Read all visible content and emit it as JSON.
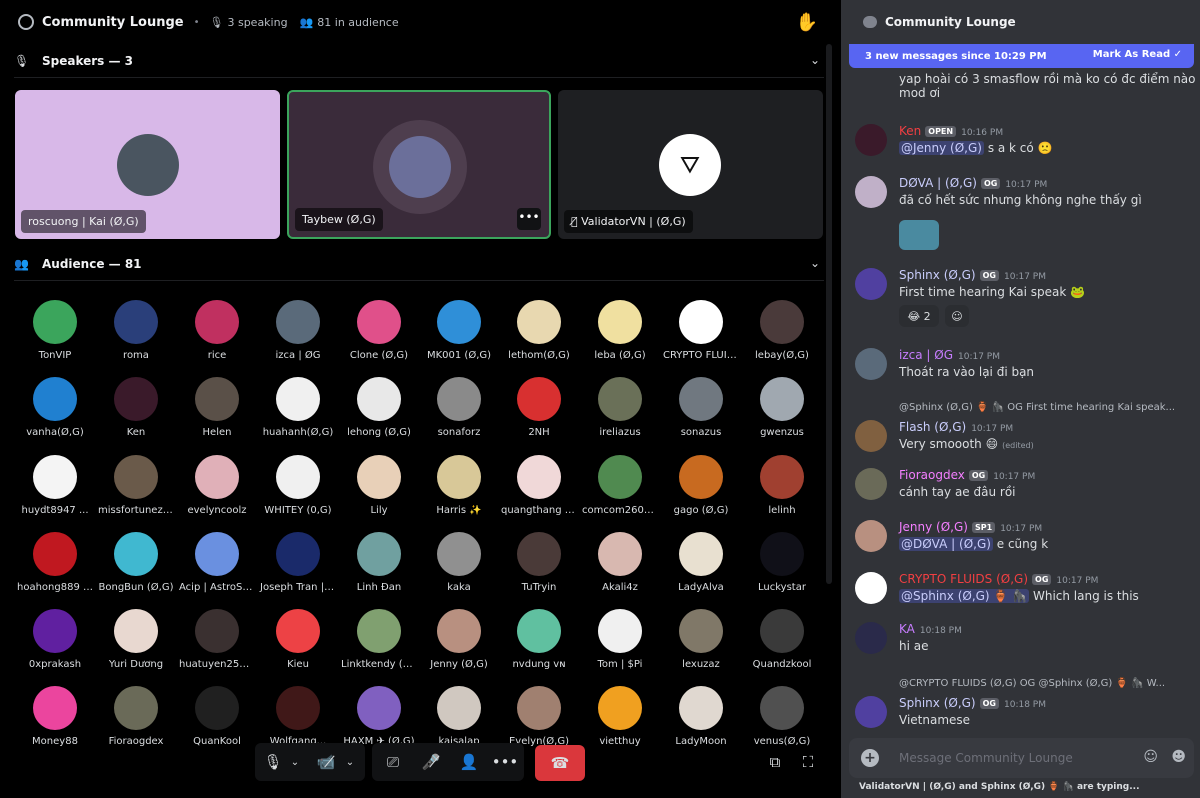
{
  "header": {
    "title": "Community Lounge",
    "speaking": "3 speaking",
    "audience": "81 in audience"
  },
  "speakers_section": {
    "title": "Speakers — 3"
  },
  "speakers": [
    {
      "label": "roscuong | Kai (Ø,G)",
      "bg": "#d8b8e8",
      "avatar": "#4a5560"
    },
    {
      "label": "Taybew (Ø,G)",
      "bg": "#3a2b3a",
      "avatar": "#6b6f9a"
    },
    {
      "label": "ValidatorVN | (Ø,G)",
      "bg": "#1e1f22",
      "avatar": "#ffffff"
    }
  ],
  "audience_section": {
    "title": "Audience — 81"
  },
  "audience": [
    {
      "name": "TonVIP",
      "color": "#3ba55c"
    },
    {
      "name": "roma",
      "color": "#2a3f7a"
    },
    {
      "name": "rice",
      "color": "#c03060"
    },
    {
      "name": "izca | ØG",
      "color": "#5a6a7a"
    },
    {
      "name": "Clone (Ø,G)",
      "color": "#e0508a"
    },
    {
      "name": "MK001 (Ø,G)",
      "color": "#2f8fd8"
    },
    {
      "name": "lethom(Ø,G)",
      "color": "#e8d8b0"
    },
    {
      "name": "leba (Ø,G)",
      "color": "#f0e0a0"
    },
    {
      "name": "CRYPTO FLUID...",
      "color": "#ffffff"
    },
    {
      "name": "lebay(Ø,G)",
      "color": "#4a3a3a"
    },
    {
      "name": "vanha(Ø,G)",
      "color": "#2080d0"
    },
    {
      "name": "Ken",
      "color": "#3a1a2a"
    },
    {
      "name": "Helen",
      "color": "#5a5048"
    },
    {
      "name": "huahanh(Ø,G)",
      "color": "#f0f0f0"
    },
    {
      "name": "lehong (Ø,G)",
      "color": "#e8e8e8"
    },
    {
      "name": "sonaforz",
      "color": "#8a8a8a"
    },
    {
      "name": "2NH",
      "color": "#d83030"
    },
    {
      "name": "ireliazus",
      "color": "#6a7058"
    },
    {
      "name": "sonazus",
      "color": "#707880"
    },
    {
      "name": "gwenzus",
      "color": "#a0a8b0"
    },
    {
      "name": "huydt8947 ...",
      "color": "#f4f4f4"
    },
    {
      "name": "missfortunezus",
      "color": "#6a5a4a"
    },
    {
      "name": "evelyncoolz",
      "color": "#e0b0b8"
    },
    {
      "name": "WHITEY (0,G)",
      "color": "#f0f0f0"
    },
    {
      "name": "Lily",
      "color": "#e8d0b8"
    },
    {
      "name": "Harris ✨",
      "color": "#d8c898"
    },
    {
      "name": "quangthang (...",
      "color": "#f0d8d8"
    },
    {
      "name": "comcom2608...",
      "color": "#508a50"
    },
    {
      "name": "gago (Ø,G)",
      "color": "#c86a20"
    },
    {
      "name": "lelinh",
      "color": "#a04030"
    },
    {
      "name": "hoahong889 (...",
      "color": "#c01820"
    },
    {
      "name": "BongBun (Ø,G)",
      "color": "#40b8d0"
    },
    {
      "name": "Acip | AstroSt...",
      "color": "#6a90e0"
    },
    {
      "name": "Joseph Tran | ...",
      "color": "#1a2a6a"
    },
    {
      "name": "Linh Đan",
      "color": "#70a0a0"
    },
    {
      "name": "kaka",
      "color": "#909090"
    },
    {
      "name": "TuTryin",
      "color": "#4a3a38"
    },
    {
      "name": "Akali4z",
      "color": "#d8b8b0"
    },
    {
      "name": "LadyAlva",
      "color": "#e8e0d0"
    },
    {
      "name": "Luckystar",
      "color": "#101018"
    },
    {
      "name": "0xprakash",
      "color": "#6020a0"
    },
    {
      "name": "Yuri Dương",
      "color": "#e8d8d0"
    },
    {
      "name": "huatuyen2512...",
      "color": "#3a3030"
    },
    {
      "name": "Kieu",
      "color": "#ed4245"
    },
    {
      "name": "Linktkendy (Ø...",
      "color": "#80a070"
    },
    {
      "name": "Jenny (Ø,G)",
      "color": "#b89080"
    },
    {
      "name": "nvdung ᴠɴ",
      "color": "#60c0a0"
    },
    {
      "name": "Tom | $Pi",
      "color": "#f0f0f0"
    },
    {
      "name": "lexuzaz",
      "color": "#807868"
    },
    {
      "name": "Quandzkool",
      "color": "#3a3a3a"
    },
    {
      "name": "Money88",
      "color": "#eb459e"
    },
    {
      "name": "Fioraogdex",
      "color": "#6a6a58"
    },
    {
      "name": "QuanKool",
      "color": "#202020"
    },
    {
      "name": "Wolfgang...",
      "color": "#401818"
    },
    {
      "name": "HAXM ✈ (Ø,G)",
      "color": "#8060c0"
    },
    {
      "name": "kaisalap",
      "color": "#d0c8c0"
    },
    {
      "name": "Evelyn(Ø,G)",
      "color": "#a08070"
    },
    {
      "name": "vietthuy",
      "color": "#f0a020"
    },
    {
      "name": "LadyMoon",
      "color": "#e0d8d0"
    },
    {
      "name": "venus(Ø,G)",
      "color": "#505050"
    }
  ],
  "chat": {
    "title": "Community Lounge",
    "new_messages": "3 new messages since 10:29 PM",
    "mark_read": "Mark As Read",
    "messages": [
      {
        "text": "yap hoài có 3 smasflow rồi mà ko có đc điểm nào mod ơi"
      },
      {
        "name": "Ken",
        "name_color": "#f23f42",
        "badge": "OPEN",
        "time": "10:16 PM",
        "mention": "@Jenny (Ø,G)",
        "text": "s a k có 🙁",
        "avatar": "#3a1a2a"
      },
      {
        "name": "DØVA | (Ø,G)",
        "name_color": "#c9cdfb",
        "badge": "OG",
        "time": "10:17 PM",
        "text": "đã cố hết sức nhưng không nghe thấy gì",
        "avatar": "#c0b0c8"
      },
      {
        "name": "Sphinx (Ø,G)",
        "name_color": "#c9cdfb",
        "badge": "OG",
        "time": "10:17 PM",
        "text": "First time hearing Kai speak 🐸",
        "avatar": "#5040a0",
        "reaction": "😂 2"
      },
      {
        "name": "izca | ØG",
        "name_color": "#c77dff",
        "time": "10:17 PM",
        "text": "Thoát ra vào lại đi bạn",
        "avatar": "#5a6a7a"
      },
      {
        "reply": "@Sphinx (Ø,G) 🏺 🦍 OG First time hearing Kai speak...",
        "name": "Flash (Ø,G)",
        "name_color": "#c9cdfb",
        "time": "10:17 PM",
        "text": "Very smoooth 😄",
        "edited": "(edited)",
        "avatar": "#806040"
      },
      {
        "name": "Fioraogdex",
        "name_color": "#f47fff",
        "badge": "OG",
        "time": "10:17 PM",
        "text": "cánh tay ae đâu rồi",
        "avatar": "#6a6a58"
      },
      {
        "name": "Jenny (Ø,G)",
        "name_color": "#f47fff",
        "badge": "SP1",
        "time": "10:17 PM",
        "mention": "@DØVA | (Ø,G)",
        "text": "e cũng k",
        "avatar": "#b89080"
      },
      {
        "name": "CRYPTO FLUIDS (Ø,G)",
        "name_color": "#f23f42",
        "badge": "OG",
        "time": "10:17 PM",
        "mention": "@Sphinx (Ø,G) 🏺 🦍",
        "text": "Which lang is this",
        "avatar": "#ffffff"
      },
      {
        "name": "KA",
        "name_color": "#c77dff",
        "time": "10:18 PM",
        "text": "hi ae",
        "avatar": "#2a2a4a"
      },
      {
        "reply": "@CRYPTO FLUIDS (Ø,G) OG @Sphinx (Ø,G) 🏺 🦍 W...",
        "name": "Sphinx (Ø,G)",
        "name_color": "#c9cdfb",
        "badge": "OG",
        "time": "10:18 PM",
        "text": "Vietnamese",
        "avatar": "#5040a0"
      }
    ],
    "input_placeholder": "Message Community Lounge",
    "typing": "ValidatorVN | (Ø,G) and Sphinx (Ø,G) 🏺 🦍 are typing..."
  }
}
